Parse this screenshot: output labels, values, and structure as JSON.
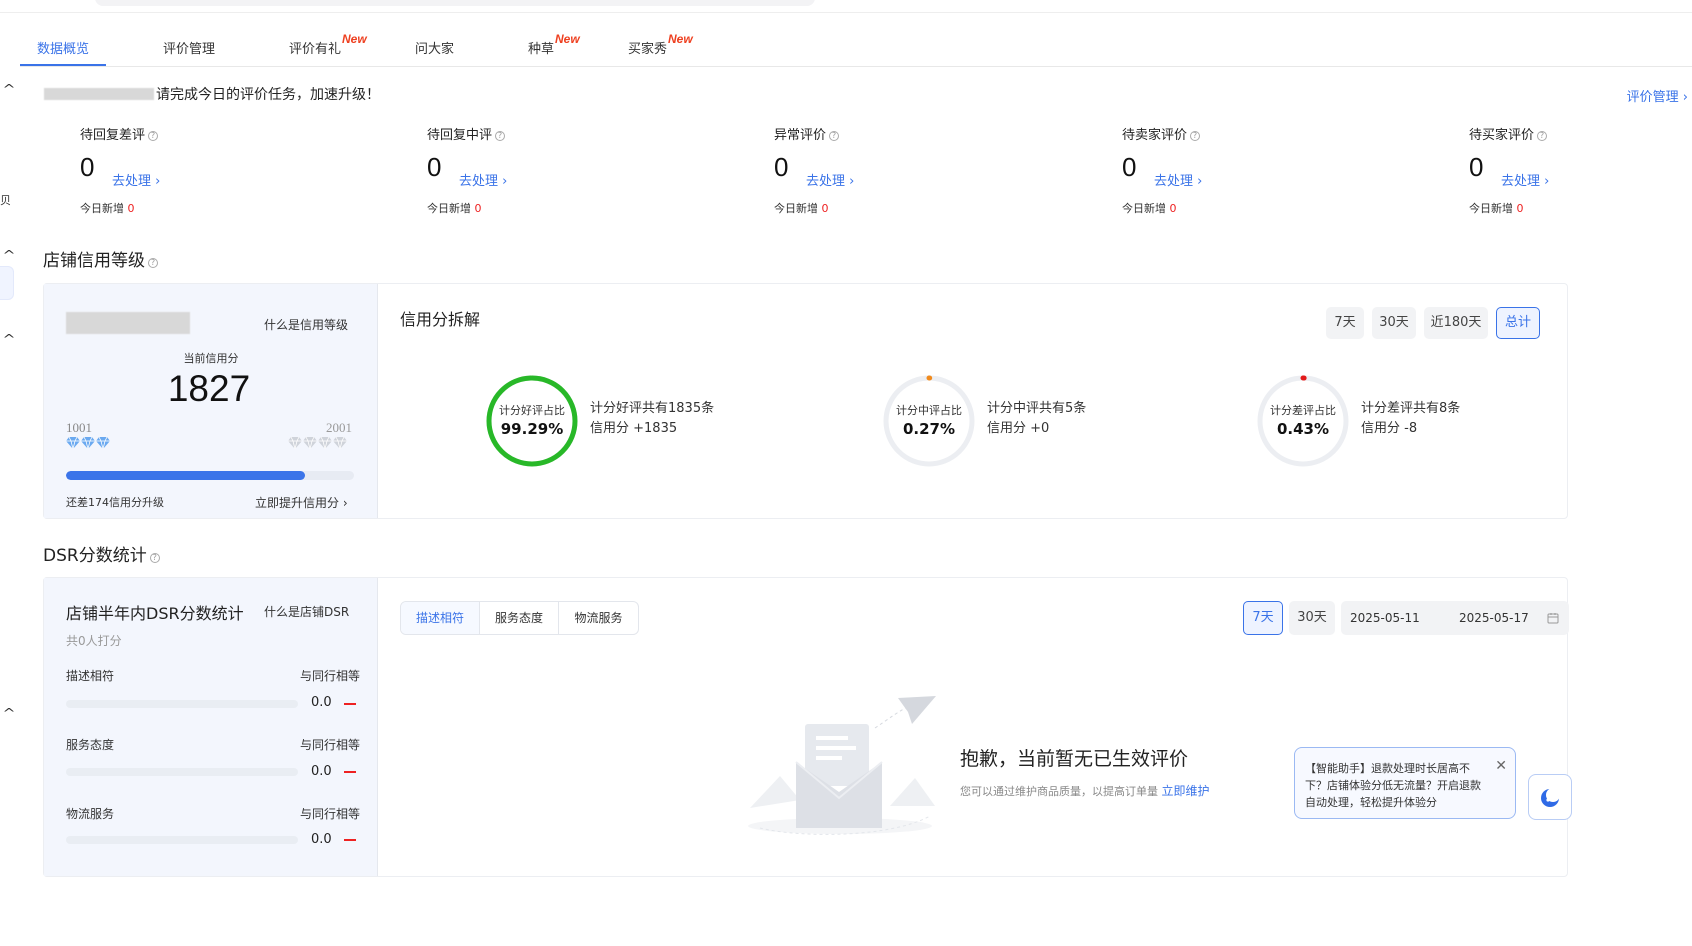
{
  "tabs": [
    {
      "label": "数据概览",
      "badge": ""
    },
    {
      "label": "评价管理",
      "badge": ""
    },
    {
      "label": "评价有礼",
      "badge": "New"
    },
    {
      "label": "问大家",
      "badge": ""
    },
    {
      "label": "种草",
      "badge": "New"
    },
    {
      "label": "买家秀",
      "badge": "New"
    }
  ],
  "sidebar_rail": {
    "char": "贝"
  },
  "task": {
    "text": "请完成今日的评价任务，加速升级！",
    "review_management_link": "评价管理 ›"
  },
  "stats": [
    {
      "title": "待回复差评",
      "value": "0",
      "action": "去处理 ›",
      "today_label": "今日新增",
      "today_value": "0"
    },
    {
      "title": "待回复中评",
      "value": "0",
      "action": "去处理 ›",
      "today_label": "今日新增",
      "today_value": "0"
    },
    {
      "title": "异常评价",
      "value": "0",
      "action": "去处理 ›",
      "today_label": "今日新增",
      "today_value": "0"
    },
    {
      "title": "待卖家评价",
      "value": "0",
      "action": "去处理 ›",
      "today_label": "今日新增",
      "today_value": "0"
    },
    {
      "title": "待买家评价",
      "value": "0",
      "action": "去处理 ›",
      "today_label": "今日新增",
      "today_value": "0"
    }
  ],
  "credit": {
    "section_title": "店铺信用等级",
    "what_is_link": "什么是信用等级",
    "current_label": "当前信用分",
    "score": "1827",
    "range_min": "1001",
    "range_max": "2001",
    "progress_fraction": 0.83,
    "gap_text": "还差174信用分升级",
    "improve_link": "立即提升信用分 ›",
    "breakdown_title": "信用分拆解",
    "period_buttons": [
      "7天",
      "30天",
      "近180天",
      "总计"
    ],
    "active_period": "总计",
    "rings": [
      {
        "label": "计分好评占比",
        "percent": "99.29%",
        "fraction": 0.9929,
        "color": "#28b828",
        "desc1": "计分好评共有1835条",
        "desc2": "信用分 +1835"
      },
      {
        "label": "计分中评占比",
        "percent": "0.27%",
        "fraction": 0.0027,
        "color": "#f08a1c",
        "desc1": "计分中评共有5条",
        "desc2": "信用分 +0"
      },
      {
        "label": "计分差评占比",
        "percent": "0.43%",
        "fraction": 0.0043,
        "color": "#e21a1a",
        "desc1": "计分差评共有8条",
        "desc2": "信用分 -8"
      }
    ]
  },
  "dsr": {
    "section_title": "DSR分数统计",
    "card_title": "店铺半年内DSR分数统计",
    "what_is_link": "什么是店铺DSR",
    "raters": "共0人打分",
    "rows": [
      {
        "label": "描述相符",
        "peer": "与同行相等",
        "value": "0.0"
      },
      {
        "label": "服务态度",
        "peer": "与同行相等",
        "value": "0.0"
      },
      {
        "label": "物流服务",
        "peer": "与同行相等",
        "value": "0.0"
      }
    ],
    "segments": [
      "描述相符",
      "服务态度",
      "物流服务"
    ],
    "active_segment": "描述相符",
    "period_buttons": [
      "7天",
      "30天"
    ],
    "active_period": "7天",
    "date_start": "2025-05-11",
    "date_end": "2025-05-17",
    "empty_title": "抱歉，当前暂无已生效评价",
    "empty_desc": "您可以通过维护商品质量，以提高订单量",
    "empty_link": "立即维护"
  },
  "assistant": {
    "text": "【智能助手】退款处理时长居高不下？店铺体验分低无流量？开启退款自动处理，轻松提升体验分",
    "close": "✕"
  },
  "colors": {
    "accent": "#3a73e8",
    "new_badge": "#ee3f1f",
    "danger": "#e22222"
  }
}
